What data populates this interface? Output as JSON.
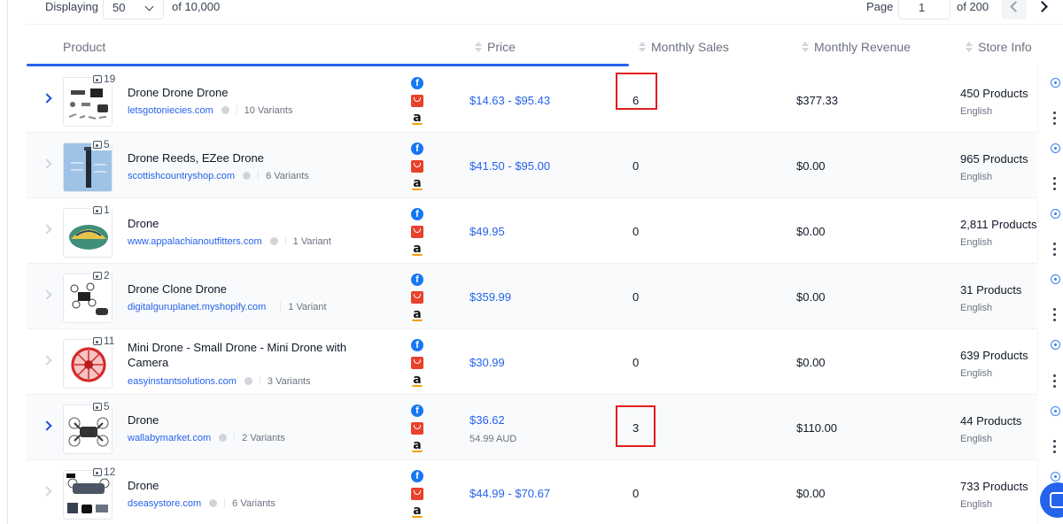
{
  "toolbar": {
    "displaying_label": "Displaying",
    "per_page": "50",
    "of_total": "of 10,000",
    "page_label": "Page",
    "page_value": "1",
    "of_pages": "of 200"
  },
  "columns": {
    "product": "Product",
    "price": "Price",
    "monthly_sales": "Monthly Sales",
    "monthly_revenue": "Monthly Revenue",
    "store_info": "Store Info"
  },
  "rows": [
    {
      "img_count": "19",
      "name": "Drone Drone Drone",
      "store": "letsgotoniecies.com",
      "variants": "10 Variants",
      "price": "$14.63 - $95.43",
      "price_sub": "",
      "sales": "6",
      "revenue": "$377.33",
      "products": "450 Products",
      "language": "English"
    },
    {
      "img_count": "5",
      "name": "Drone Reeds, EZee Drone",
      "store": "scottishcountryshop.com",
      "variants": "6 Variants",
      "price": "$41.50 - $95.00",
      "price_sub": "",
      "sales": "0",
      "revenue": "$0.00",
      "products": "965 Products",
      "language": "English"
    },
    {
      "img_count": "1",
      "name": "Drone",
      "store": "www.appalachianoutfitters.com",
      "variants": "1 Variant",
      "price": "$49.95",
      "price_sub": "",
      "sales": "0",
      "revenue": "$0.00",
      "products": "2,811 Products",
      "language": "English"
    },
    {
      "img_count": "2",
      "name": "Drone Clone Drone",
      "store": "digitalguruplanet.myshopify.com",
      "variants": "1 Variant",
      "price": "$359.99",
      "price_sub": "",
      "sales": "0",
      "revenue": "$0.00",
      "products": "31 Products",
      "language": "English"
    },
    {
      "img_count": "11",
      "name": "Mini Drone - Small Drone - Mini Drone with Camera",
      "store": "easyinstantsolutions.com",
      "variants": "3 Variants",
      "price": "$30.99",
      "price_sub": "",
      "sales": "0",
      "revenue": "$0.00",
      "products": "639 Products",
      "language": "English"
    },
    {
      "img_count": "5",
      "name": "Drone",
      "store": "wallabymarket.com",
      "variants": "2 Variants",
      "price": "$36.62",
      "price_sub": "54.99 AUD",
      "sales": "3",
      "revenue": "$110.00",
      "products": "44 Products",
      "language": "English"
    },
    {
      "img_count": "12",
      "name": "Drone",
      "store": "dseasystore.com",
      "variants": "6 Variants",
      "price": "$44.99 - $70.67",
      "price_sub": "",
      "sales": "0",
      "revenue": "$0.00",
      "products": "733 Products",
      "language": "English"
    }
  ],
  "platform_icons": [
    "facebook-icon",
    "aliexpress-icon",
    "amazon-icon"
  ],
  "fb_glyph": "f",
  "amz_glyph": "a",
  "colors": {
    "accent": "#2563eb",
    "highlight_box": "#e11d1d",
    "facebook": "#1877f2",
    "aliexpress": "#e8412c"
  }
}
